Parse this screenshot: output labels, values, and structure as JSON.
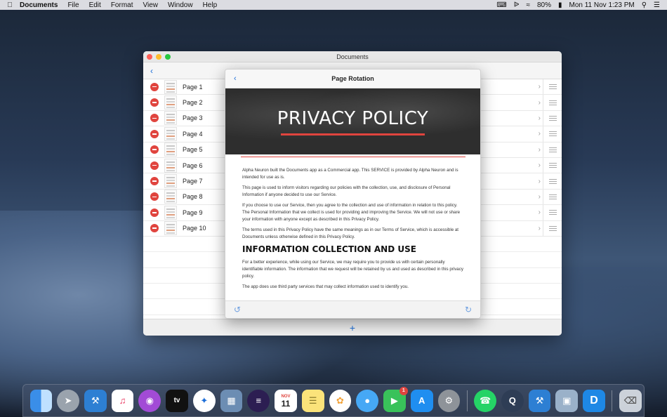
{
  "menubar": {
    "app_name": "Documents",
    "menus": [
      "File",
      "Edit",
      "Format",
      "View",
      "Window",
      "Help"
    ],
    "battery": "80%",
    "clock": "Mon 11 Nov  1:23 PM"
  },
  "window": {
    "title": "Documents",
    "pages": [
      "Page 1",
      "Page 2",
      "Page 3",
      "Page 4",
      "Page 5",
      "Page 6",
      "Page 7",
      "Page 8",
      "Page 9",
      "Page 10"
    ]
  },
  "sheet": {
    "title": "Page Rotation",
    "banner_title": "PRIVACY POLICY",
    "paragraphs": [
      "Alpha Neuron built the Documents app as a Commercial app. This SERVICE is provided by Alpha Neuron and is intended for use as is.",
      "This page is used to inform visitors regarding our policies with the collection, use, and disclosure of Personal Information if anyone decided to use our Service.",
      "If you choose to use our Service, then you agree to the collection and use of information in relation to this policy. The Personal Information that we collect is used for providing and improving the Service. We will not use or share your information with anyone except as described in this Privacy Policy.",
      "The terms used in this Privacy Policy have the same meanings as in our Terms of Service, which is accessible at Documents unless otherwise defined in this Privacy Policy."
    ],
    "heading": "INFORMATION COLLECTION AND USE",
    "paragraphs2": [
      "For a better experience, while using our Service, we may require you to provide us with certain personally identifiable information. The information that we request will be retained by us and used as described in this privacy policy.",
      "The app does use third party services that may collect information used to identify you."
    ]
  },
  "dock": {
    "calendar_month": "NOV",
    "calendar_day": "11",
    "appletv_label": "tv",
    "facetime_badge": "1",
    "documents_letter": "D"
  },
  "colors": {
    "accent": "#1e6fd9",
    "delete": "#e0443e",
    "banner": "#2e2e2e"
  }
}
